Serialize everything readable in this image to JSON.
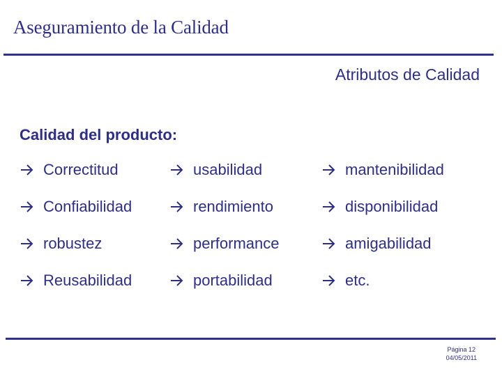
{
  "slide": {
    "title": "Aseguramiento de la Calidad",
    "subtitle": "Atributos de Calidad",
    "section_heading": "Calidad del producto:",
    "bullet_icon": "arrow-right-icon",
    "attribute_columns": [
      {
        "items": [
          "Correctitud",
          "Confiabilidad",
          "robustez",
          "Reusabilidad"
        ]
      },
      {
        "items": [
          "usabilidad",
          "rendimiento",
          "performance",
          "portabilidad"
        ]
      },
      {
        "items": [
          "mantenibilidad",
          "disponibilidad",
          "amigabilidad",
          "etc."
        ]
      }
    ],
    "footer": {
      "page_label": "Página 12",
      "date": "04/05/2011"
    }
  },
  "colors": {
    "text": "#2e2e86",
    "rule": "#30308f",
    "background": "#ffffff"
  }
}
